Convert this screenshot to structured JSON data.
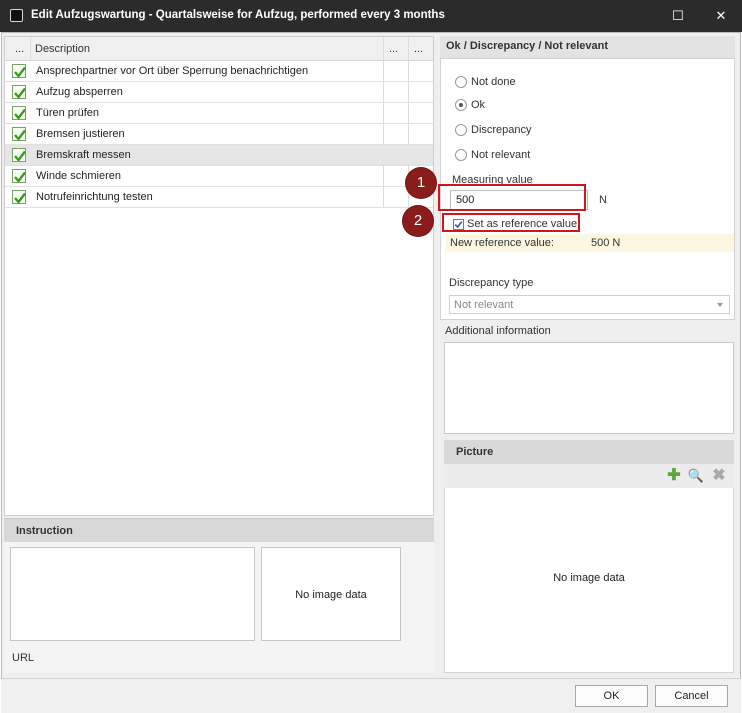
{
  "window": {
    "title": "Edit Aufzugswartung - Quartalsweise for Aufzug, performed every 3 months",
    "maximize_glyph": "☐",
    "close_glyph": "✕"
  },
  "checklist": {
    "columns": [
      "...",
      "Description",
      "...",
      "..."
    ],
    "items": [
      {
        "label": "Ansprechpartner vor Ort über Sperrung benachrichtigen",
        "checked": true
      },
      {
        "label": "Aufzug absperren",
        "checked": true
      },
      {
        "label": "Türen prüfen",
        "checked": true
      },
      {
        "label": "Bremsen justieren",
        "checked": true
      },
      {
        "label": "Bremskraft messen",
        "checked": true,
        "selected": true
      },
      {
        "label": "Winde schmieren",
        "checked": true
      },
      {
        "label": "Notrufeinrichtung testen",
        "checked": true
      }
    ]
  },
  "instruction": {
    "header": "Instruction",
    "image_placeholder": "No image data",
    "url_label": "URL"
  },
  "status": {
    "header": "Ok / Discrepancy / Not relevant",
    "options": [
      {
        "label": "Not done",
        "selected": false
      },
      {
        "label": "Ok",
        "selected": true
      },
      {
        "label": "Discrepancy",
        "selected": false
      },
      {
        "label": "Not relevant",
        "selected": false
      }
    ],
    "measuring_label": "Measuring value",
    "measuring_value": "500",
    "unit": "N",
    "reference_checkbox_label": "Set as reference value",
    "reference_checked": true,
    "new_reference_label": "New reference value:",
    "new_reference_value": "500 N",
    "discrepancy_type_label": "Discrepancy type",
    "discrepancy_type_value": "Not relevant"
  },
  "additional_info": {
    "label": "Additional information"
  },
  "picture": {
    "header": "Picture",
    "add_glyph": "✚",
    "search_glyph": "🔍",
    "delete_glyph": "✖",
    "placeholder": "No image data"
  },
  "footer": {
    "ok_label": "OK",
    "cancel_label": "Cancel"
  },
  "callouts": [
    "1",
    "2"
  ],
  "colors": {
    "titlebar": "#2b2b2b",
    "callout_badge": "#8b1c1c",
    "callout_border": "#d0161c",
    "check_green": "#4caf2a",
    "add_icon_green": "#5aa83a"
  }
}
